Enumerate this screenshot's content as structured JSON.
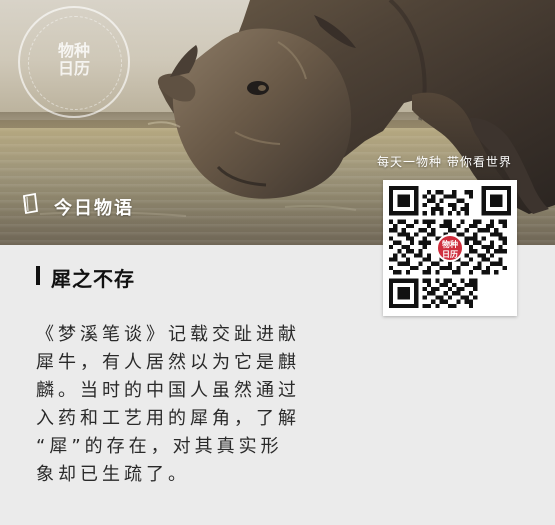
{
  "colors": {
    "background": "#ebebeb",
    "title_bar": "#111111",
    "body_text": "#2a2a2a",
    "accent_red": "#cf2e3d",
    "white": "#ffffff"
  },
  "photo": {
    "stamp": {
      "main_line_1": "物种",
      "main_line_2": "日历"
    },
    "headline": "今日物语",
    "motto": "每天一物种 带你看世界",
    "qr": {
      "center_line_1": "物种",
      "center_line_2": "日历"
    }
  },
  "article": {
    "title": "犀之不存",
    "lines": [
      "《梦溪笔谈》记载交趾进献",
      "犀牛，有人居然以为它是麒",
      "麟。当时的中国人虽然通过",
      "入药和工艺用的犀角，了解",
      "“犀”的存在，对其真实形",
      "象却已生疏了。"
    ]
  },
  "icons": {
    "book": "book-icon",
    "stamp": "seal-icon",
    "qr": "qr-code-icon"
  }
}
